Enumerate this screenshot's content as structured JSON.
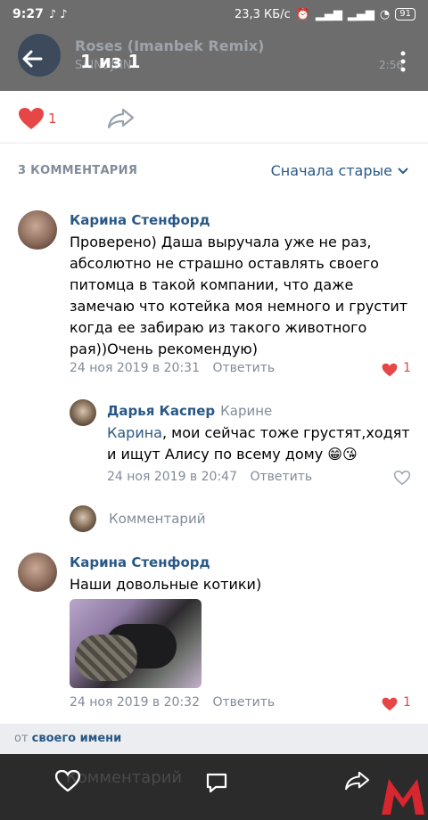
{
  "status": {
    "time": "9:27",
    "speed": "23,3 КБ/с",
    "battery": "91"
  },
  "music": {
    "title": "Roses (Imanbek Remix)",
    "artist": "SAINt JHN",
    "duration": "2:56"
  },
  "viewer": {
    "pager": "1 из 1"
  },
  "actions": {
    "like_count": "1"
  },
  "comments": {
    "header": "3 КОММЕНТАРИЯ",
    "sort_label": "Сначала старые",
    "items": [
      {
        "author": "Карина Стенфорд",
        "lines": [
          "Проверено) Даша выручала уже не раз,",
          "абсолютно не страшно оставлять своего",
          "питомца в такой компании, что даже",
          "замечаю что котейка моя немного и грустит",
          "когда ее забираю из такого животного",
          "рая))Очень рекомендую)"
        ],
        "date": "24 ноя 2019 в 20:31",
        "reply_label": "Ответить",
        "likes": "1"
      },
      {
        "author": "Дарья Каспер",
        "to": "Карине",
        "mention": "Карина",
        "line1_rest": ", мои сейчас тоже грустят,ходят",
        "line2": "и ищут Алису по всему дому",
        "emoji": "😁😘",
        "date": "24 ноя 2019 в 20:47",
        "reply_label": "Ответить"
      },
      {
        "author": "Карина Стенфорд",
        "text": "Наши довольные котики)",
        "date": "24 ноя 2019 в 20:32",
        "reply_label": "Ответить",
        "likes": "1"
      }
    ],
    "reply_placeholder": "Комментарий"
  },
  "from": {
    "prefix": "от",
    "link": "своего имени"
  },
  "bottom": {
    "ghost_text": "Комментарий"
  }
}
